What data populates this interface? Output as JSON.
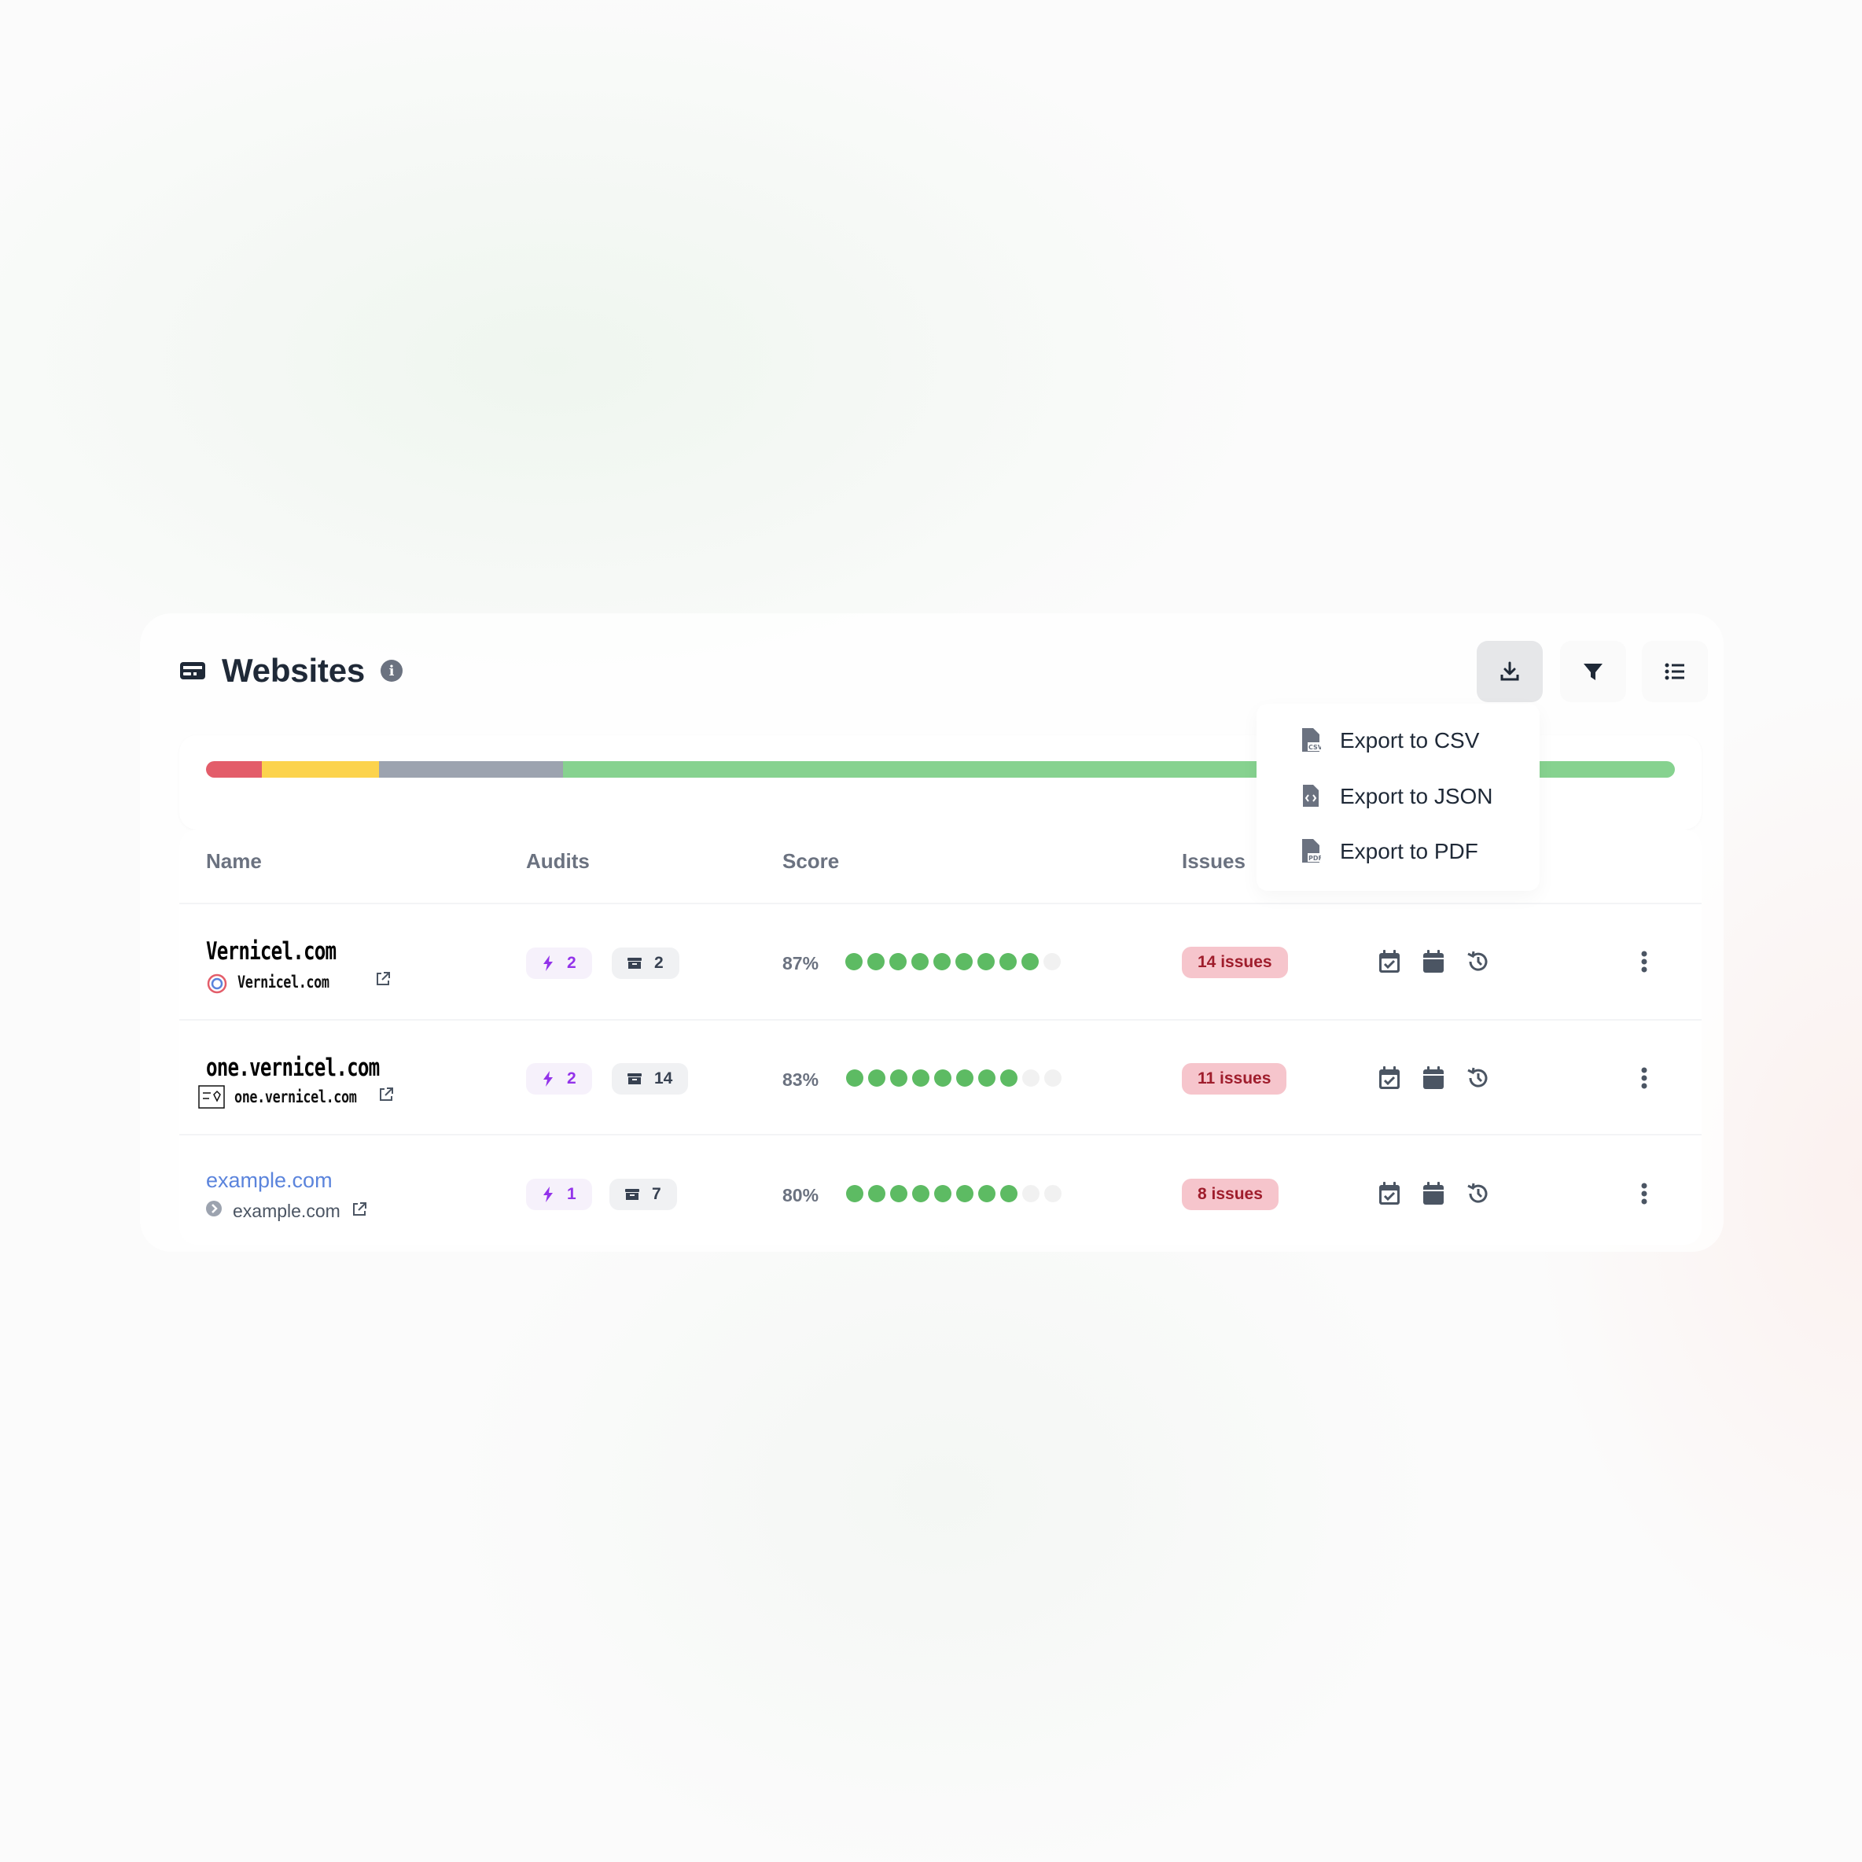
{
  "colors": {
    "accent_green": "#5dbb63",
    "link_blue": "#5b84dc",
    "issue_bg": "#f6c5cc",
    "issue_fg": "#9f1d2c",
    "bolt": "#9333ea"
  },
  "header": {
    "title": "Websites",
    "icon": "monitor-icon",
    "info_icon": "info-icon"
  },
  "toolbar": {
    "download_icon": "download-icon",
    "filter_icon": "filter-icon",
    "list_icon": "list-icon"
  },
  "summary_bar": [
    {
      "status": "poor",
      "color": "#e35d6a",
      "fraction": 0.038
    },
    {
      "status": "fair",
      "color": "#fcd34d",
      "fraction": 0.08
    },
    {
      "status": "unknown",
      "color": "#9ca3af",
      "fraction": 0.125
    },
    {
      "status": "good",
      "color": "#86d28f",
      "fraction": 0.757
    }
  ],
  "export_menu": {
    "items": [
      {
        "label": "Export to CSV",
        "icon": "file-csv-icon"
      },
      {
        "label": "Export to JSON",
        "icon": "file-code-icon"
      },
      {
        "label": "Export to PDF",
        "icon": "file-pdf-icon"
      }
    ]
  },
  "table": {
    "columns": [
      "Name",
      "Audits",
      "Score",
      "Issues"
    ],
    "rows": [
      {
        "name": "Vernicel.com",
        "domain": "Vernicel.com",
        "audits_running": "2",
        "audits_archived": "2",
        "score": "87%",
        "score_dots": 9,
        "issues": "14 issues"
      },
      {
        "name": "one.vernicel.com",
        "domain": "one.vernicel.com",
        "audits_running": "2",
        "audits_archived": "14",
        "score": "83%",
        "score_dots": 8,
        "issues": "11 issues"
      },
      {
        "name": "example.com",
        "domain": "example.com",
        "audits_running": "1",
        "audits_archived": "7",
        "score": "80%",
        "score_dots": 8,
        "issues": "8 issues"
      }
    ]
  }
}
